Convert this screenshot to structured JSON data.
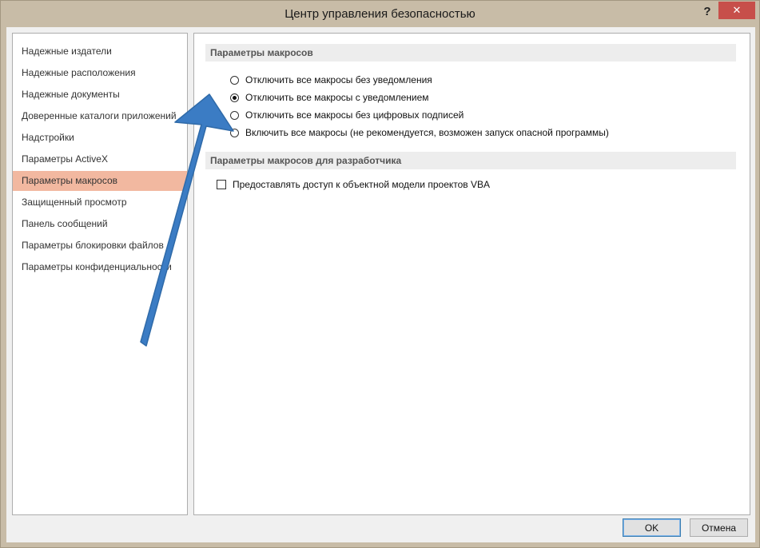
{
  "window": {
    "title": "Центр управления безопасностью",
    "help_label": "?",
    "close_label": "✕"
  },
  "sidebar": {
    "items": [
      {
        "label": "Надежные издатели"
      },
      {
        "label": "Надежные расположения"
      },
      {
        "label": "Надежные документы"
      },
      {
        "label": "Доверенные каталоги приложений"
      },
      {
        "label": "Надстройки"
      },
      {
        "label": "Параметры ActiveX"
      },
      {
        "label": "Параметры макросов",
        "selected": true
      },
      {
        "label": "Защищенный просмотр"
      },
      {
        "label": "Панель сообщений"
      },
      {
        "label": "Параметры блокировки файлов"
      },
      {
        "label": "Параметры конфиденциальности"
      }
    ]
  },
  "macro_settings": {
    "header": "Параметры макросов",
    "options": [
      {
        "label": "Отключить все макросы без уведомления",
        "checked": false
      },
      {
        "label": "Отключить все макросы с уведомлением",
        "checked": true
      },
      {
        "label": "Отключить все макросы без цифровых подписей",
        "checked": false
      },
      {
        "label": "Включить все макросы (не рекомендуется, возможен запуск опасной программы)",
        "checked": false
      }
    ]
  },
  "developer_settings": {
    "header": "Параметры макросов для разработчика",
    "vba_access_label": "Предоставлять доступ к объектной модели проектов VBA",
    "vba_access_checked": false
  },
  "footer": {
    "ok_label": "OK",
    "cancel_label": "Отмена"
  },
  "colors": {
    "selection": "#f2b8a0",
    "arrow": "#3b7cc4",
    "close_button": "#c74f4a"
  }
}
